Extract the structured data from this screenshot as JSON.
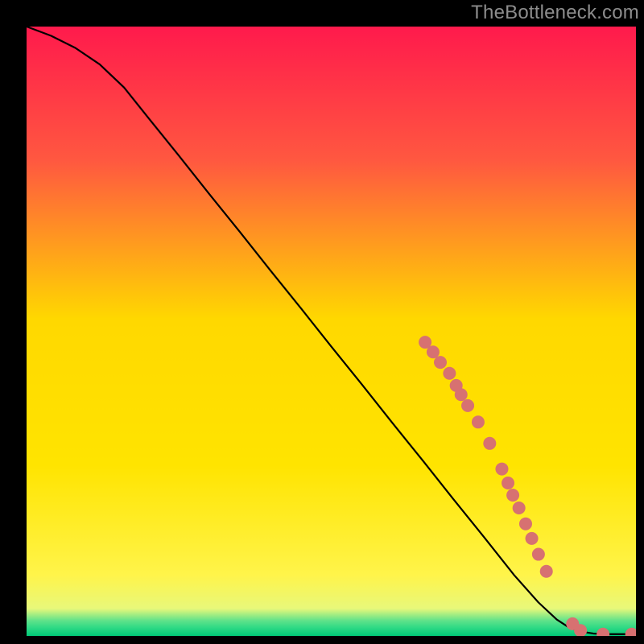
{
  "watermark": "TheBottleneck.com",
  "chart_data": {
    "type": "line",
    "xlim": [
      0,
      100
    ],
    "ylim": [
      0,
      100
    ],
    "curve": [
      {
        "x": 0,
        "y": 100.0
      },
      {
        "x": 4,
        "y": 98.5
      },
      {
        "x": 8,
        "y": 96.5
      },
      {
        "x": 12,
        "y": 93.8
      },
      {
        "x": 16,
        "y": 90.0
      },
      {
        "x": 20,
        "y": 85.0
      },
      {
        "x": 25,
        "y": 78.8
      },
      {
        "x": 30,
        "y": 72.5
      },
      {
        "x": 35,
        "y": 66.3
      },
      {
        "x": 40,
        "y": 60.0
      },
      {
        "x": 45,
        "y": 53.8
      },
      {
        "x": 50,
        "y": 47.5
      },
      {
        "x": 55,
        "y": 41.3
      },
      {
        "x": 60,
        "y": 35.0
      },
      {
        "x": 65,
        "y": 28.8
      },
      {
        "x": 70,
        "y": 22.5
      },
      {
        "x": 75,
        "y": 16.3
      },
      {
        "x": 80,
        "y": 10.0
      },
      {
        "x": 84,
        "y": 5.5
      },
      {
        "x": 87,
        "y": 2.7
      },
      {
        "x": 89,
        "y": 1.4
      },
      {
        "x": 91,
        "y": 0.7
      },
      {
        "x": 93,
        "y": 0.4
      },
      {
        "x": 95,
        "y": 0.3
      },
      {
        "x": 97,
        "y": 0.3
      },
      {
        "x": 100,
        "y": 0.3
      }
    ],
    "markers": [
      {
        "x": 65.4,
        "y": 48.2
      },
      {
        "x": 66.7,
        "y": 46.6
      },
      {
        "x": 67.9,
        "y": 44.9
      },
      {
        "x": 69.4,
        "y": 43.1
      },
      {
        "x": 70.5,
        "y": 41.1
      },
      {
        "x": 71.3,
        "y": 39.6
      },
      {
        "x": 72.4,
        "y": 37.8
      },
      {
        "x": 74.1,
        "y": 35.1
      },
      {
        "x": 76.0,
        "y": 31.6
      },
      {
        "x": 78.0,
        "y": 27.4
      },
      {
        "x": 79.0,
        "y": 25.1
      },
      {
        "x": 79.8,
        "y": 23.1
      },
      {
        "x": 80.8,
        "y": 21.0
      },
      {
        "x": 81.9,
        "y": 18.4
      },
      {
        "x": 82.9,
        "y": 16.0
      },
      {
        "x": 84.0,
        "y": 13.4
      },
      {
        "x": 85.3,
        "y": 10.6
      },
      {
        "x": 89.6,
        "y": 2.0
      },
      {
        "x": 90.9,
        "y": 0.9
      },
      {
        "x": 94.6,
        "y": 0.3
      },
      {
        "x": 99.3,
        "y": 0.3
      }
    ],
    "greenBand": {
      "from": 0,
      "to": 3
    },
    "title": "",
    "xlabel": "",
    "ylabel": ""
  },
  "colors": {
    "marker": "#d77171",
    "curve": "#000000",
    "gradTop": "#ff1a4c",
    "gradUpper": "#ff7a3a",
    "gradMid": "#ffd800",
    "gradLower": "#fff44a",
    "gradGreen1": "#d9f58c",
    "gradGreen2": "#5fe28a",
    "gradGreen3": "#00c977"
  }
}
